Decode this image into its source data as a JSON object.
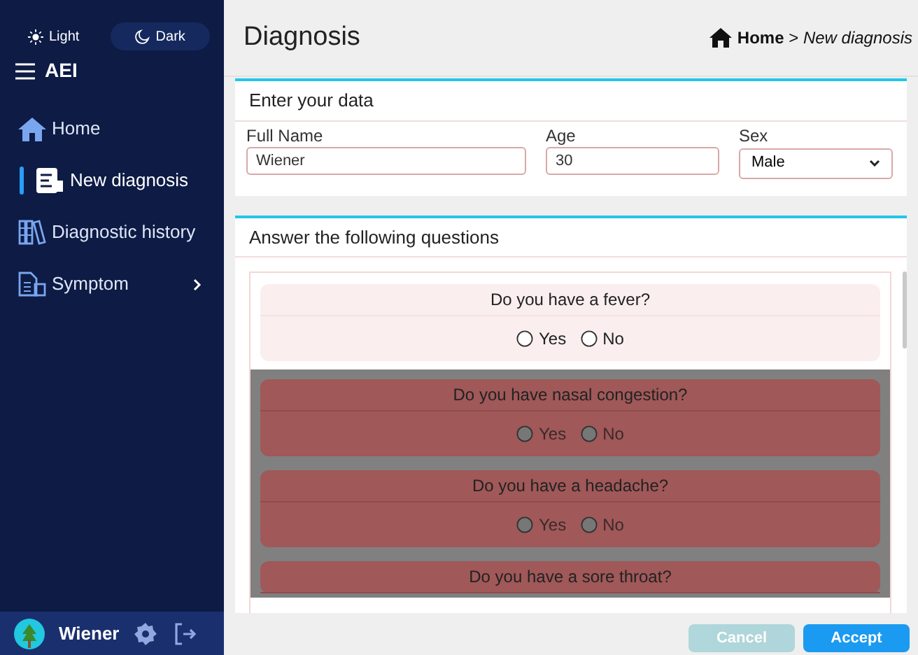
{
  "theme_toggle": [
    {
      "label": "Light",
      "selected": false
    },
    {
      "label": "Dark",
      "selected": true
    }
  ],
  "app_name": "AEI",
  "nav": [
    {
      "label": "Home",
      "selected": false,
      "submenu": false
    },
    {
      "label": "New diagnosis",
      "selected": true,
      "submenu": false
    },
    {
      "label": "Diagnostic history",
      "selected": false,
      "submenu": false
    },
    {
      "label": "Symptom",
      "selected": false,
      "submenu": true
    }
  ],
  "user": {
    "name": "Wiener"
  },
  "page_title": "Diagnosis",
  "breadcrumb": {
    "home": "Home",
    "separator": ">",
    "current": "New diagnosis"
  },
  "data_card": {
    "title": "Enter your data",
    "fields": [
      {
        "label": "Full Name",
        "value": "Wiener",
        "kind": "text"
      },
      {
        "label": "Age",
        "value": "30",
        "kind": "text"
      },
      {
        "label": "Sex",
        "value": "Male",
        "kind": "select"
      }
    ]
  },
  "questions_card": {
    "title": "Answer the following questions",
    "questions": [
      {
        "text": "Do you have a fever?",
        "disabled": false,
        "options": [
          {
            "label": "Yes",
            "selected": false
          },
          {
            "label": "No",
            "selected": false
          }
        ]
      },
      {
        "text": "Do you have nasal congestion?",
        "disabled": true,
        "options": [
          {
            "label": "Yes",
            "selected": false
          },
          {
            "label": "No",
            "selected": false
          }
        ]
      },
      {
        "text": "Do you have a headache?",
        "disabled": true,
        "options": [
          {
            "label": "Yes",
            "selected": false
          },
          {
            "label": "No",
            "selected": false
          }
        ]
      },
      {
        "text": "Do you have a sore throat?",
        "disabled": true
      }
    ]
  },
  "buttons": [
    {
      "label": "Cancel",
      "kind": "secondary",
      "disabled": true
    },
    {
      "label": "Accept",
      "kind": "primary",
      "disabled": false
    }
  ]
}
